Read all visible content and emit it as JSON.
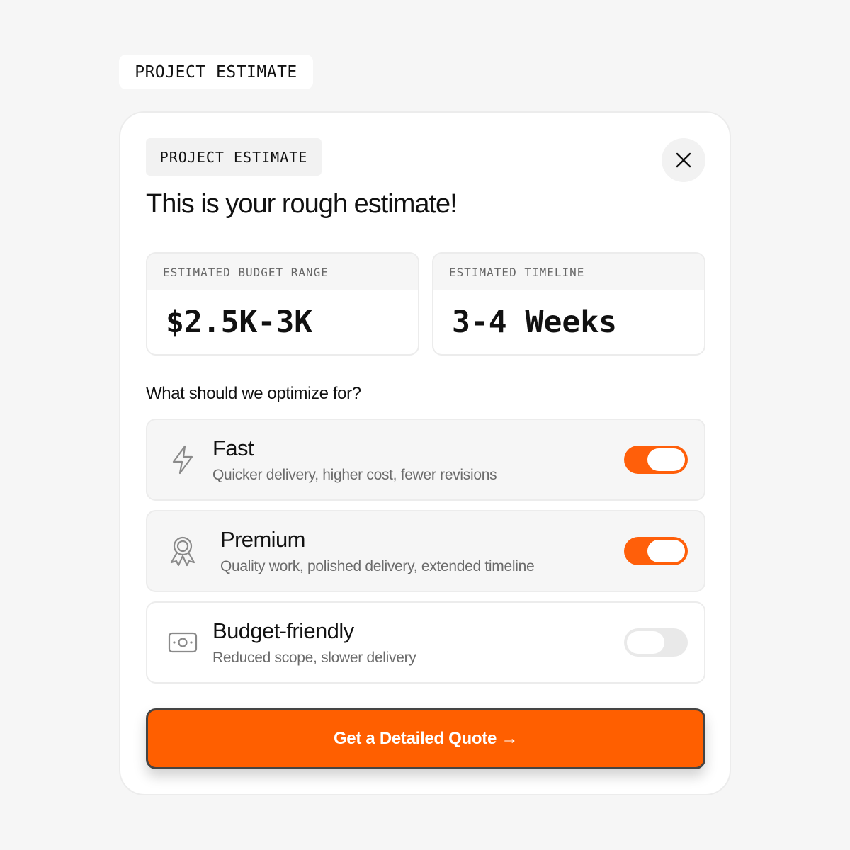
{
  "page_tag": "PROJECT ESTIMATE",
  "card": {
    "tag": "PROJECT ESTIMATE",
    "close_icon": "close-icon",
    "headline": "This is your rough estimate!",
    "metrics": [
      {
        "label": "ESTIMATED BUDGET RANGE",
        "value": "$2.5K-3K"
      },
      {
        "label": "ESTIMATED TIMELINE",
        "value": "3-4 Weeks"
      }
    ],
    "question": "What should we optimize for?",
    "options": [
      {
        "icon": "lightning-bolt-icon",
        "title": "Fast",
        "description": "Quicker delivery, higher cost, fewer revisions",
        "enabled": true
      },
      {
        "icon": "award-ribbon-icon",
        "title": "Premium",
        "description": "Quality work, polished delivery, extended timeline",
        "enabled": true
      },
      {
        "icon": "banknote-icon",
        "title": "Budget-friendly",
        "description": "Reduced scope, slower delivery",
        "enabled": false
      }
    ],
    "cta_label": "Get a Detailed Quote →"
  },
  "colors": {
    "accent": "#ff5f00",
    "background": "#f6f6f6",
    "toggle_off": "#e9e9e9"
  }
}
